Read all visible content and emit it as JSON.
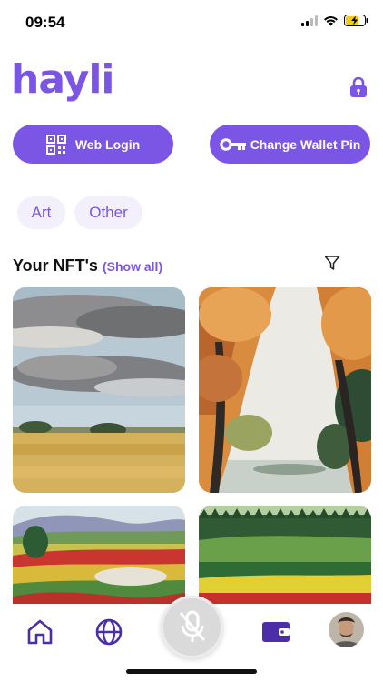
{
  "status_bar": {
    "time": "09:54"
  },
  "header": {
    "logo_text": "hayli",
    "lock_icon": "lock-icon"
  },
  "actions": {
    "web_login_label": "Web Login",
    "change_pin_label": "Change Wallet Pin"
  },
  "categories": [
    {
      "label": "Art"
    },
    {
      "label": "Other"
    }
  ],
  "nfts_section": {
    "title": "Your NFT's",
    "show_all_label": "(Show all)"
  },
  "nft_cards": [
    {
      "name": "nft-card-cloudy-field"
    },
    {
      "name": "nft-card-autumn-trees"
    },
    {
      "name": "nft-card-colorful-hills"
    },
    {
      "name": "nft-card-green-fields"
    }
  ],
  "tab_bar": {
    "items": [
      "home-icon",
      "globe-icon",
      "mic-off-icon",
      "wallet-icon",
      "avatar"
    ]
  },
  "colors": {
    "accent": "#7b55e4",
    "chip_bg": "#f3f0fb",
    "mic_bg": "#dadada"
  }
}
